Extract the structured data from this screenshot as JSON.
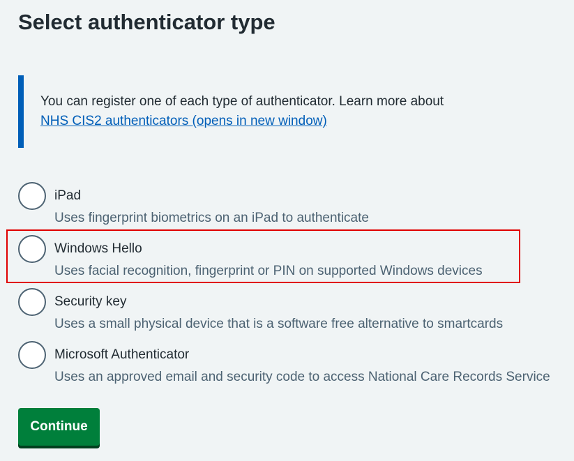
{
  "page": {
    "title": "Select authenticator type"
  },
  "inset": {
    "text": "You can register one of each type of authenticator. Learn more about",
    "link_label": "NHS CIS2 authenticators (opens in new window)"
  },
  "options": [
    {
      "label": "iPad",
      "hint": "Uses fingerprint biometrics on an iPad to authenticate",
      "selected": false
    },
    {
      "label": "Windows Hello",
      "hint": "Uses facial recognition, fingerprint or PIN on supported Windows devices",
      "selected": false,
      "highlighted": true
    },
    {
      "label": "Security key",
      "hint": "Uses a small physical device that is a software free alternative to smartcards",
      "selected": false
    },
    {
      "label": "Microsoft Authenticator",
      "hint": "Uses an approved email and security code to access National Care Records Service",
      "selected": false
    }
  ],
  "actions": {
    "continue_label": "Continue"
  },
  "colors": {
    "background": "#f0f4f5",
    "text": "#212b32",
    "hint_text": "#4c6272",
    "link": "#005eb8",
    "inset_border": "#005eb8",
    "button": "#007f3b",
    "button_shadow": "#00401e",
    "highlight": "#e00000"
  }
}
